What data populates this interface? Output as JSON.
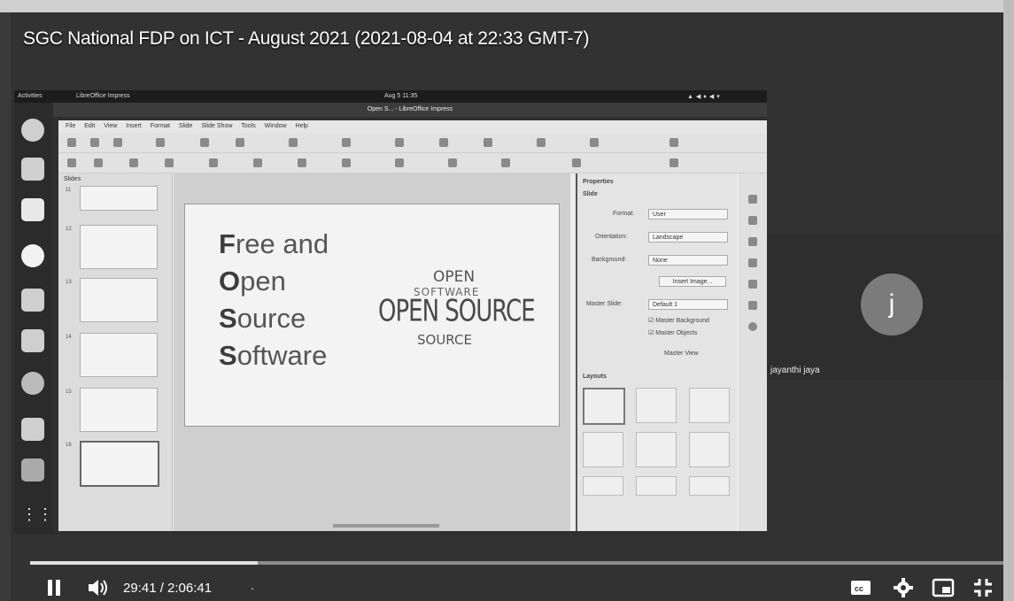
{
  "video": {
    "title": "SGC National FDP on ICT - August 2021 (2021-08-04 at 22:33 GMT-7)"
  },
  "screen": {
    "topbar": {
      "activities": "Activities",
      "app_menu": "LibreOffice Impress",
      "clock": "Aug 5 11:35"
    },
    "window_title": "Open S... - LibreOffice Impress",
    "menubar": [
      "File",
      "Edit",
      "View",
      "Insert",
      "Format",
      "Slide",
      "Slide Show",
      "Tools",
      "Window",
      "Help"
    ],
    "slides_panel": {
      "heading": "Slides",
      "numbers": [
        "11",
        "12",
        "13",
        "14",
        "15",
        "16"
      ]
    },
    "slide": {
      "lines": [
        {
          "cap": "F",
          "rest": "ree and"
        },
        {
          "cap": "O",
          "rest": "pen"
        },
        {
          "cap": "S",
          "rest": "ource"
        },
        {
          "cap": "S",
          "rest": "oftware"
        }
      ],
      "wordcloud": [
        "OPEN",
        "SOFTWARE",
        "OPEN SOURCE",
        "SOURCE"
      ]
    },
    "properties": {
      "heading": "Properties",
      "slide_section": "Slide",
      "format_label": "Format:",
      "format_value": "User",
      "orientation_label": "Orientation:",
      "orientation_value": "Landscape",
      "background_label": "Background:",
      "background_value": "None",
      "insert_image": "Insert Image...",
      "master_slide_label": "Master Slide:",
      "master_slide_value": "Default 1",
      "master_background": "Master Background",
      "master_objects": "Master Objects",
      "master_view": "Master View",
      "layouts_heading": "Layouts"
    }
  },
  "participant": {
    "initial": "j",
    "name": "jayanthi jaya"
  },
  "player": {
    "time": "29:41 / 2:06:41",
    "dot": "·",
    "progress": 0.234
  },
  "icons": [
    "pause-icon",
    "volume-icon",
    "captions-icon",
    "settings-icon",
    "miniplayer-icon",
    "exit-fullscreen-icon"
  ]
}
